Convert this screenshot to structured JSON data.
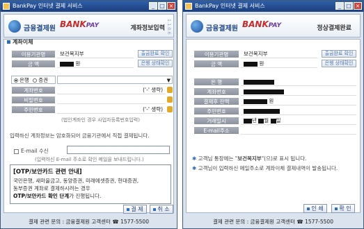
{
  "left": {
    "title": "BankPay 인터넷 결제 서비스",
    "org": "금융결제원",
    "brand_main": "BANK",
    "brand_sub": "PAY",
    "header_title": "계좌정보입력",
    "version": "1.1.0.6",
    "section": "계좌이체",
    "merchant_label": "이용기관명",
    "merchant_value": "보건복지부",
    "amount_label": "금 액",
    "amount_unit": "원",
    "receipt_button": "출금완료 확인",
    "status_button": "은행 상태확인",
    "radio_bank": "은행",
    "radio_securities": "증권",
    "account_label": "계좌번호",
    "password_label": "비밀번호",
    "id_label": "주민번호",
    "dash_hint": "('-' 생략)",
    "corp_note": "(법인계좌인 경우 사업자등록번호입력)",
    "encrypt_msg": "입력하신 계좌정보는 암호화되어 금융기관에서 직접 결제됩니다.",
    "email_label": "E-mail 수신",
    "email_note": "(입력하신 E-mail 주소로 확인 메일을 보내드립니다.)",
    "otp_title": "[OTP/보안카드 관련 안내]",
    "otp_lines": [
      "국민은행, 새마을금고, 동양증권, 미래에셋증권, 현대증권,",
      "동부증권 계좌로 결제하시려는 경우"
    ],
    "otp_bold": "OTP/보안카드 확인 단계",
    "otp_tail": "가 진행됩니다.",
    "pay_button": "결 제",
    "cancel_button": "취 소",
    "footer": "결제 관련 문의 : 금융결제원 고객센터 ☎ 1577-5500"
  },
  "right": {
    "title": "BankPay 인터넷 결제 서비스",
    "org": "금융결제원",
    "brand_main": "BANK",
    "brand_sub": "PAY",
    "header_title": "정상결제완료",
    "merchant_label": "이용기관명",
    "merchant_value": "보건복지부",
    "amount_label": "금 액",
    "amount_unit": "원",
    "receipt_button": "출금완료 확인",
    "status_button": "은행 상태확인",
    "bank_label": "은 행",
    "account_label": "계좌번호",
    "balance_label": "결제후 잔액",
    "balance_unit": "원",
    "id_label": "주민번호",
    "date_label": "거래일시",
    "date_year": "년",
    "date_month": "월",
    "date_day": "일",
    "email_label": "E-mail주소",
    "notice1_pre": "고객님 통장에는 \"",
    "notice1_name": "보건복지부",
    "notice1_post": "\"(으)로 표시 됩니다.",
    "notice2": "고객님이 입력하신 메일주소로 계좌이체 결제내역이 발송됩니다.",
    "print_button": "인 쇄",
    "confirm_button": "확 인",
    "footer": "결제 관련 문의 : 금융결제원 고객센터 ☎ 1577-5500"
  }
}
